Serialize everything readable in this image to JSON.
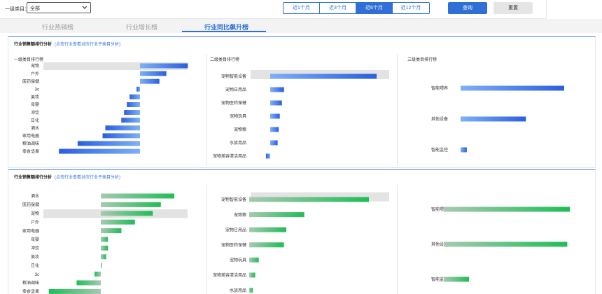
{
  "filter": {
    "label": "一级类目：",
    "selected": "全部"
  },
  "time_range": {
    "options": [
      "近1个月",
      "近3个月",
      "近6个月",
      "近12个月"
    ],
    "active_index": 2
  },
  "buttons": {
    "query": "查询",
    "reset": "重置"
  },
  "tabs": [
    "行业热销榜",
    "行业增长榜",
    "行业同比飙升榜"
  ],
  "sections": [
    {
      "title": "行业销售额排行分析",
      "hint": "(点击行业查看对应行业子类目分析)",
      "panels": [
        {
          "title": "一级类目排行榜",
          "highlight": 0,
          "items": [
            {
              "name": "宠物",
              "value": 69
            },
            {
              "name": "户外",
              "value": 38
            },
            {
              "name": "医药保健",
              "value": 28
            },
            {
              "name": "3c",
              "value": -5
            },
            {
              "name": "美妆",
              "value": -15
            },
            {
              "name": "母婴",
              "value": -19
            },
            {
              "name": "冲饮",
              "value": -23
            },
            {
              "name": "日化",
              "value": -27
            },
            {
              "name": "酒水",
              "value": -50
            },
            {
              "name": "家用电器",
              "value": -54
            },
            {
              "name": "粮油调味",
              "value": -90
            },
            {
              "name": "零食坚果",
              "value": -117
            }
          ]
        },
        {
          "title": "二级类目排行榜",
          "highlight": 0,
          "items": [
            {
              "name": "宠物智能设备",
              "value": 100
            },
            {
              "name": "宠物日用品",
              "value": 13
            },
            {
              "name": "宠物医药保健",
              "value": 11
            },
            {
              "name": "宠物玩具",
              "value": 9
            },
            {
              "name": "宠物粮",
              "value": 8
            },
            {
              "name": "水族用品",
              "value": 7
            },
            {
              "name": "宠物美容清洁用品",
              "value": -4
            }
          ]
        },
        {
          "title": "三级类目排行榜",
          "highlight": -1,
          "items": [
            {
              "name": "智能喂养",
              "value": 100
            },
            {
              "name": "其他设备",
              "value": 63
            },
            {
              "name": "智能监控",
              "value": 6
            }
          ]
        }
      ]
    },
    {
      "title": "行业销售额排行分析",
      "hint": "(点击行业查看对应行业子类目分析)",
      "panels": [
        {
          "title": "",
          "highlight": 2,
          "items": [
            {
              "name": "酒水",
              "value": 82
            },
            {
              "name": "医药保健",
              "value": 67
            },
            {
              "name": "宠物",
              "value": 58
            },
            {
              "name": "户外",
              "value": 38
            },
            {
              "name": "家用电器",
              "value": 23
            },
            {
              "name": "母婴",
              "value": 8
            },
            {
              "name": "冲饮",
              "value": 8
            },
            {
              "name": "美妆",
              "value": 6
            },
            {
              "name": "日化",
              "value": 1
            },
            {
              "name": "3c",
              "value": -7
            },
            {
              "name": "粮油调味",
              "value": -27
            },
            {
              "name": "零食坚果",
              "value": -58
            }
          ]
        },
        {
          "title": "",
          "highlight": 0,
          "items": [
            {
              "name": "宠物智能设备",
              "value": 100
            },
            {
              "name": "宠物粮",
              "value": 46
            },
            {
              "name": "宠物日用品",
              "value": 31
            },
            {
              "name": "宠物医药保健",
              "value": 29
            },
            {
              "name": "宠物玩具",
              "value": 8
            },
            {
              "name": "宠物美容清洁用品",
              "value": 5
            },
            {
              "name": "水族用品",
              "value": 3
            }
          ]
        },
        {
          "title": "",
          "highlight": -1,
          "items": [
            {
              "name": "智能喂养",
              "value": 100
            },
            {
              "name": "其他设备",
              "value": 98
            },
            {
              "name": "智能监控",
              "value": 20
            }
          ]
        }
      ]
    }
  ],
  "colors": {
    "blue_start": "#7fb0f5",
    "blue_end": "#2a5fe0",
    "green_start": "#a7c9b2",
    "green_end": "#1fbd55",
    "highlight_bg": "#e3e3e3",
    "accent": "#2f6fd6"
  }
}
